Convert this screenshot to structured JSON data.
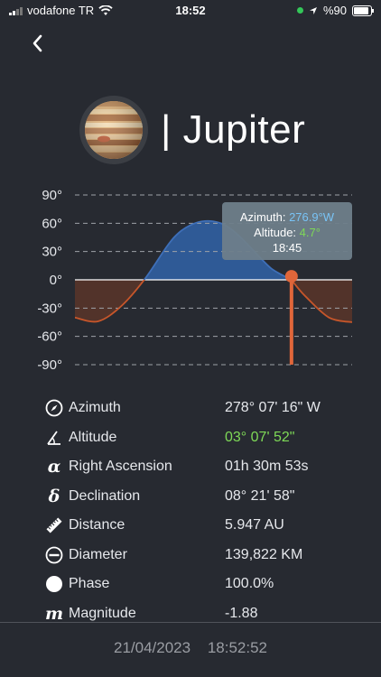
{
  "status_bar": {
    "carrier": "vodafone TR",
    "time": "18:52",
    "battery": "%90"
  },
  "header": {
    "title": "| Jupiter",
    "planet_icon": "jupiter-image"
  },
  "chart_data": {
    "type": "line",
    "ylim": [
      -90,
      90
    ],
    "y_ticks": [
      "90°",
      "60°",
      "30°",
      "0°",
      "-30°",
      "-60°",
      "-90°"
    ],
    "series": [
      {
        "x": [
          0,
          2,
          4,
          6,
          8,
          9,
          10,
          11,
          12,
          13,
          14,
          15,
          16,
          17,
          18,
          18.75,
          19,
          20,
          22,
          24
        ],
        "values": [
          -40,
          -44,
          -28,
          0,
          36,
          50,
          58,
          62,
          62,
          58,
          49,
          37,
          24,
          12,
          4.7,
          0,
          -4,
          -18,
          -40,
          -45
        ]
      }
    ],
    "current_point": {
      "azimuth": "276.9°W",
      "altitude": "4.7°",
      "time": "18:45"
    },
    "tooltip": {
      "azimuth_label": "Azimuth:",
      "azimuth_value": "276.9°W",
      "altitude_label": "Altitude:",
      "altitude_value": "4.7°",
      "time": "18:45"
    },
    "colors": {
      "above": "#2f5a96",
      "below": "#5a3529",
      "line_above": "#3e6fb8",
      "line_below": "#c7562a",
      "marker": "#e0663a",
      "tooltip_bg": "#6e7e8a"
    }
  },
  "info": [
    {
      "icon": "compass-icon",
      "label": "Azimuth",
      "value": "278° 07' 16\" W"
    },
    {
      "icon": "angle-icon",
      "label": "Altitude",
      "value": "03° 07' 52\"",
      "highlight": "#7ed957"
    },
    {
      "icon": "alpha-icon",
      "glyph": "α",
      "label": "Right Ascension",
      "value": "01h 30m 53s"
    },
    {
      "icon": "delta-icon",
      "glyph": "δ",
      "label": "Declination",
      "value": "08° 21' 58\""
    },
    {
      "icon": "ruler-icon",
      "label": "Distance",
      "value": "5.947 AU"
    },
    {
      "icon": "diameter-icon",
      "label": "Diameter",
      "value": "139,822 KM"
    },
    {
      "icon": "phase-icon",
      "label": "Phase",
      "value": "100.0%"
    },
    {
      "icon": "magnitude-icon",
      "glyph": "m",
      "label": "Magnitude",
      "value": "-1.88"
    }
  ],
  "footer": {
    "date": "21/04/2023",
    "time": "18:52:52"
  }
}
